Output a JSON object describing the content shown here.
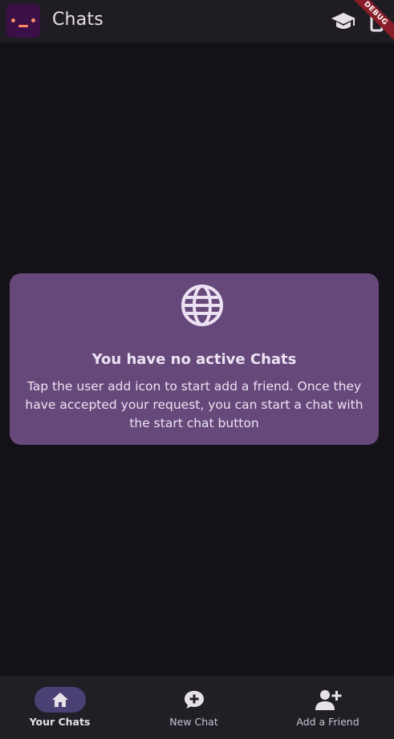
{
  "appbar": {
    "title": "Chats",
    "avatar_icon": "app-avatar-icon",
    "actions": [
      {
        "icon": "graduation-cap-icon"
      },
      {
        "icon": "device-icon"
      }
    ],
    "debug_banner": "DEBUG"
  },
  "empty_state": {
    "icon": "globe-icon",
    "title": "You have no active Chats",
    "text": "Tap the user add icon to start add a friend. Once they have accepted your request, you can start a chat with the start chat button"
  },
  "bottom_nav": {
    "items": [
      {
        "label": "Your Chats",
        "icon": "home-icon",
        "active": true
      },
      {
        "label": "New Chat",
        "icon": "chat-plus-icon",
        "active": false
      },
      {
        "label": "Add a Friend",
        "icon": "add-user-icon",
        "active": false
      }
    ]
  },
  "colors": {
    "background": "#141218",
    "appbar": "#1f1d23",
    "card": "#66497a",
    "nav_pill": "#4a4074",
    "debug": "#8a1c2a"
  }
}
